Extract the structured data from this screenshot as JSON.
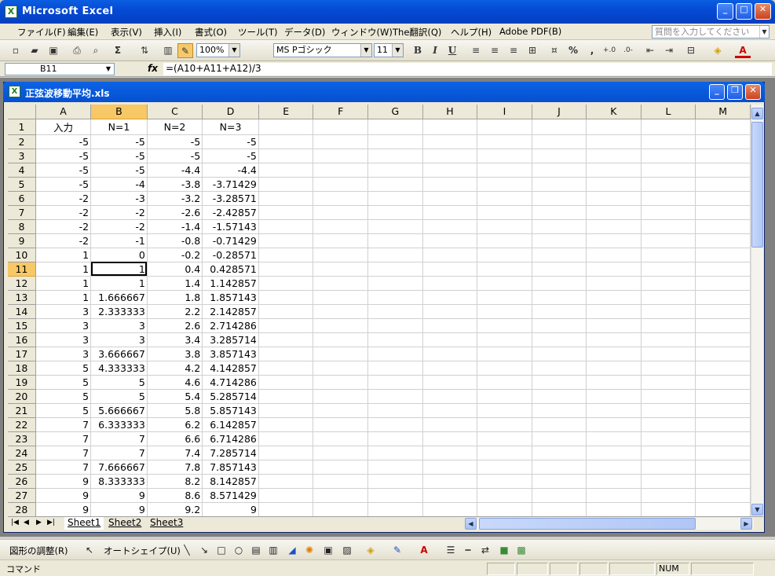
{
  "app": {
    "title": "Microsoft Excel",
    "icon": "excel-icon"
  },
  "menu": {
    "items": [
      "ファイル(F)",
      "編集(E)",
      "表示(V)",
      "挿入(I)",
      "書式(O)",
      "ツール(T)",
      "データ(D)",
      "ウィンドウ(W)",
      "The翻訳(Q)",
      "ヘルプ(H)",
      "Adobe PDF(B)"
    ],
    "help_placeholder": "質問を入力してください"
  },
  "toolbar": {
    "zoom": "100%",
    "font": "MS Pゴシック",
    "size": "11",
    "percent": "%",
    "comma": ","
  },
  "formula_bar": {
    "cell": "B11",
    "fx": "fx",
    "formula": "=(A10+A11+A12)/3"
  },
  "workbook": {
    "title": "正弦波移動平均.xls",
    "icon": "excel-workbook-icon"
  },
  "sheet": {
    "columns": [
      "A",
      "B",
      "C",
      "D",
      "E",
      "F",
      "G",
      "H",
      "I",
      "J",
      "K",
      "L",
      "M"
    ],
    "selected_column": "B",
    "selected_row": "11",
    "rows": [
      {
        "n": "1",
        "cells": [
          "入力",
          "N=1",
          "N=2",
          "N=3"
        ]
      },
      {
        "n": "2",
        "cells": [
          "-5",
          "-5",
          "-5",
          "-5"
        ]
      },
      {
        "n": "3",
        "cells": [
          "-5",
          "-5",
          "-5",
          "-5"
        ]
      },
      {
        "n": "4",
        "cells": [
          "-5",
          "-5",
          "-4.4",
          "-4.4"
        ]
      },
      {
        "n": "5",
        "cells": [
          "-5",
          "-4",
          "-3.8",
          "-3.71429"
        ]
      },
      {
        "n": "6",
        "cells": [
          "-2",
          "-3",
          "-3.2",
          "-3.28571"
        ]
      },
      {
        "n": "7",
        "cells": [
          "-2",
          "-2",
          "-2.6",
          "-2.42857"
        ]
      },
      {
        "n": "8",
        "cells": [
          "-2",
          "-2",
          "-1.4",
          "-1.57143"
        ]
      },
      {
        "n": "9",
        "cells": [
          "-2",
          "-1",
          "-0.8",
          "-0.71429"
        ]
      },
      {
        "n": "10",
        "cells": [
          "1",
          "0",
          "-0.2",
          "-0.28571"
        ]
      },
      {
        "n": "11",
        "cells": [
          "1",
          "1",
          "0.4",
          "0.428571"
        ]
      },
      {
        "n": "12",
        "cells": [
          "1",
          "1",
          "1.4",
          "1.142857"
        ]
      },
      {
        "n": "13",
        "cells": [
          "1",
          "1.666667",
          "1.8",
          "1.857143"
        ]
      },
      {
        "n": "14",
        "cells": [
          "3",
          "2.333333",
          "2.2",
          "2.142857"
        ]
      },
      {
        "n": "15",
        "cells": [
          "3",
          "3",
          "2.6",
          "2.714286"
        ]
      },
      {
        "n": "16",
        "cells": [
          "3",
          "3",
          "3.4",
          "3.285714"
        ]
      },
      {
        "n": "17",
        "cells": [
          "3",
          "3.666667",
          "3.8",
          "3.857143"
        ]
      },
      {
        "n": "18",
        "cells": [
          "5",
          "4.333333",
          "4.2",
          "4.142857"
        ]
      },
      {
        "n": "19",
        "cells": [
          "5",
          "5",
          "4.6",
          "4.714286"
        ]
      },
      {
        "n": "20",
        "cells": [
          "5",
          "5",
          "5.4",
          "5.285714"
        ]
      },
      {
        "n": "21",
        "cells": [
          "5",
          "5.666667",
          "5.8",
          "5.857143"
        ]
      },
      {
        "n": "22",
        "cells": [
          "7",
          "6.333333",
          "6.2",
          "6.142857"
        ]
      },
      {
        "n": "23",
        "cells": [
          "7",
          "7",
          "6.6",
          "6.714286"
        ]
      },
      {
        "n": "24",
        "cells": [
          "7",
          "7",
          "7.4",
          "7.285714"
        ]
      },
      {
        "n": "25",
        "cells": [
          "7",
          "7.666667",
          "7.8",
          "7.857143"
        ]
      },
      {
        "n": "26",
        "cells": [
          "9",
          "8.333333",
          "8.2",
          "8.142857"
        ]
      },
      {
        "n": "27",
        "cells": [
          "9",
          "9",
          "8.6",
          "8.571429"
        ]
      },
      {
        "n": "28",
        "cells": [
          "9",
          "9",
          "9.2",
          "9"
        ]
      }
    ],
    "tabs": [
      "Sheet1",
      "Sheet2",
      "Sheet3"
    ],
    "active_tab": "Sheet1"
  },
  "drawing": {
    "adjust": "図形の調整(R)",
    "autoshape": "オートシェイプ(U)"
  },
  "status": {
    "left": "コマンド",
    "num": "NUM"
  }
}
